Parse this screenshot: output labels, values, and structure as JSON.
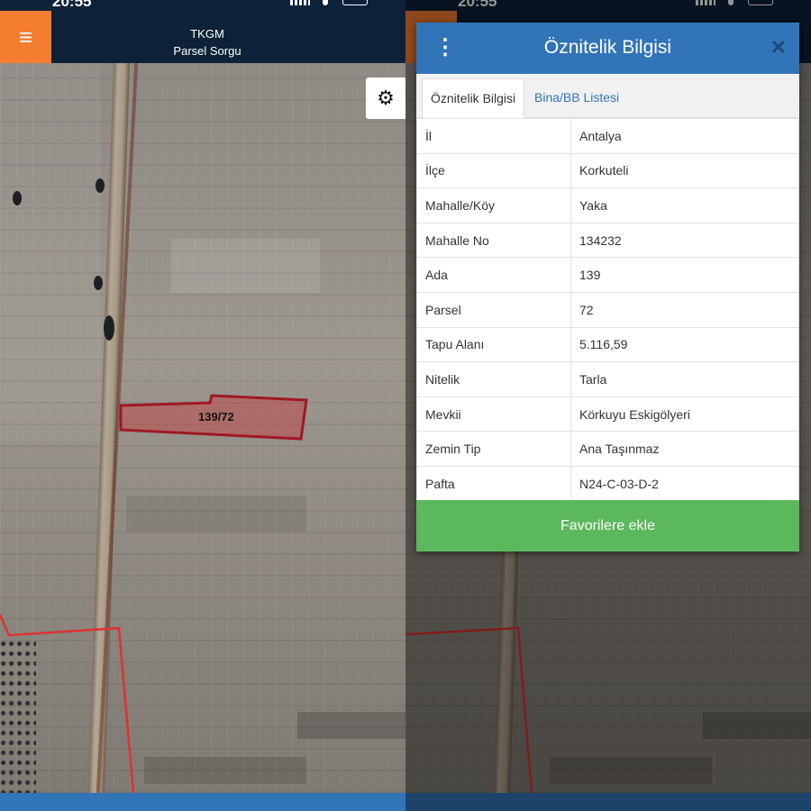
{
  "status_bar": {
    "time": "20:55"
  },
  "header": {
    "title": "TKGM",
    "subtitle": "Parsel Sorgu",
    "menu_icon": "hamburger-icon"
  },
  "map": {
    "parcel_label": "139/72",
    "settings_icon": "gear-icon"
  },
  "dialog": {
    "title": "Öznitelik Bilgisi",
    "tabs": [
      {
        "label": "Öznitelik Bilgisi",
        "active": true
      },
      {
        "label": "Bina/BB Listesi",
        "active": false
      }
    ],
    "rows": [
      {
        "key": "İl",
        "value": "Antalya"
      },
      {
        "key": "İlçe",
        "value": "Korkuteli"
      },
      {
        "key": "Mahalle/Köy",
        "value": "Yaka"
      },
      {
        "key": "Mahalle No",
        "value": "134232"
      },
      {
        "key": "Ada",
        "value": "139"
      },
      {
        "key": "Parsel",
        "value": "72"
      },
      {
        "key": "Tapu Alanı",
        "value": "5.116,59"
      },
      {
        "key": "Nitelik",
        "value": "Tarla"
      },
      {
        "key": "Mevkii",
        "value": "Körkuyu Eskigölyeri"
      },
      {
        "key": "Zemin Tip",
        "value": "Ana Taşınmaz"
      },
      {
        "key": "Pafta",
        "value": "N24-C-03-D-2"
      }
    ],
    "favorite_button": "Favorilere ekle"
  },
  "colors": {
    "header_bg": "#0d2238",
    "accent_orange": "#f47d30",
    "accent_blue": "#3274b8",
    "accent_green": "#5cb85c",
    "parcel_red": "#a01825"
  }
}
